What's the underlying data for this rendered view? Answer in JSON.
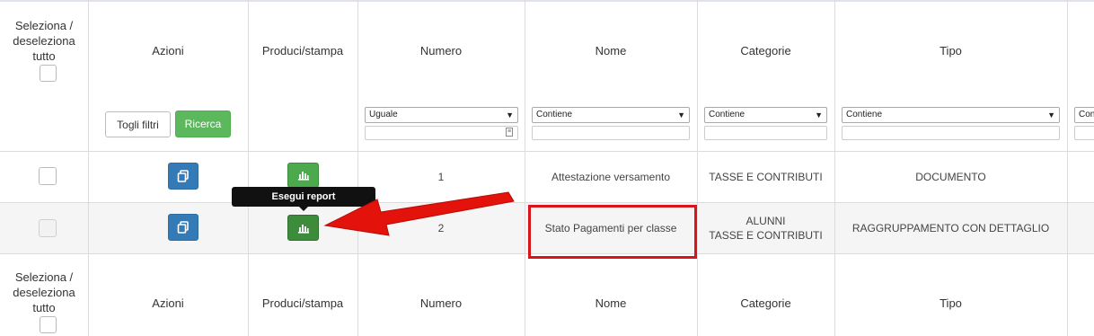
{
  "headers": {
    "select_all": [
      "Seleziona /",
      "deseleziona",
      "tutto"
    ],
    "actions": "Azioni",
    "produce": "Produci/stampa",
    "number": "Numero",
    "name": "Nome",
    "categories": "Categorie",
    "type": "Tipo"
  },
  "filters": {
    "clear_label": "Togli filtri",
    "search_label": "Ricerca",
    "number_op": "Uguale",
    "name_op": "Contiene",
    "categories_op": "Contiene",
    "type_op": "Contiene",
    "extra_op": "Con"
  },
  "rows": [
    {
      "number": "1",
      "name": "Attestazione versamento",
      "categories": [
        "TASSE E CONTRIBUTI"
      ],
      "type": "DOCUMENTO"
    },
    {
      "number": "2",
      "name": "Stato Pagamenti per classe",
      "categories": [
        "ALUNNI",
        "TASSE E CONTRIBUTI"
      ],
      "type": "RAGGRUPPAMENTO CON DETTAGLIO"
    }
  ],
  "tooltip": "Esegui report",
  "colors": {
    "annotation": "#e3120b",
    "success": "#5cb85c",
    "primary": "#337ab7"
  },
  "icons": {
    "copy": "copy-icon",
    "report": "bar-chart-icon",
    "calendar": "calendar-icon"
  }
}
